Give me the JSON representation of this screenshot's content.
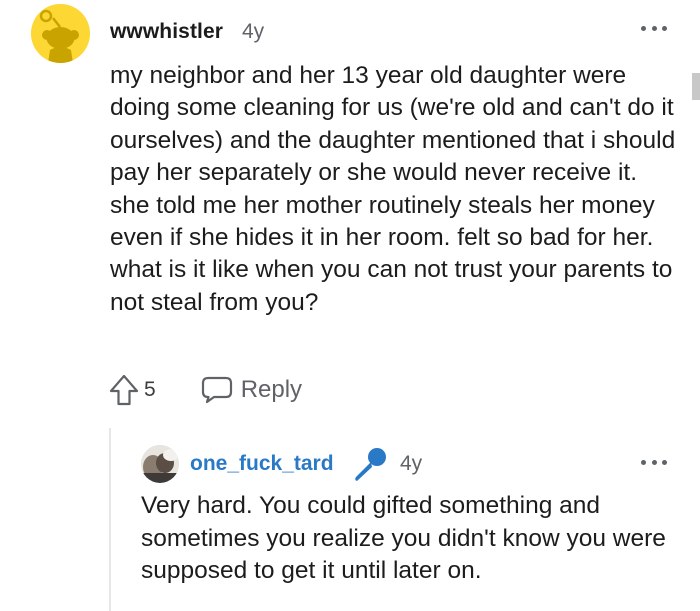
{
  "comment": {
    "username": "wwwhistler",
    "age": "4y",
    "body": "my neighbor and her 13 year old daughter were doing some cleaning for us (we're old and can't do it ourselves) and the daughter mentioned that i should pay her separately or she would never receive it. she told me her mother routinely steals her money even if she hides it in her room. felt so bad for her. what is it like when you can not trust your parents to not steal from you?",
    "upvotes": "5",
    "reply_label": "Reply"
  },
  "reply": {
    "username": "one_fuck_tard",
    "age": "4y",
    "body": "Very hard. You could gifted something and sometimes you realize you didn't know you were supposed to get it until later on."
  },
  "colors": {
    "avatar_bg": "#fdd835",
    "username_link": "#2a79c7",
    "mic_icon": "#2a79c7",
    "muted_text": "#5f6368"
  },
  "icons": {
    "comment_avatar": "reddit-snoo-avatar",
    "more": "more-horizontal-icon",
    "upvote": "upvote-arrow-icon",
    "reply": "chat-bubble-icon",
    "reply_avatar": "user-photo-avatar",
    "mic": "microphone-icon"
  }
}
